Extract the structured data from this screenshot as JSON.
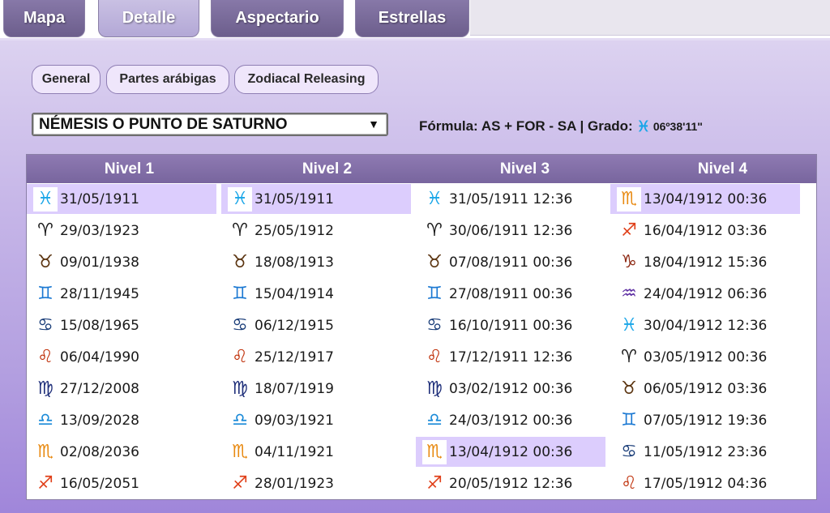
{
  "tabs": [
    {
      "label": "Mapa",
      "active": false
    },
    {
      "label": "Detalle",
      "active": true
    },
    {
      "label": "Aspectario",
      "active": false
    },
    {
      "label": "Estrellas",
      "active": false
    }
  ],
  "subtabs": [
    "General",
    "Partes arábigas",
    "Zodiacal Releasing"
  ],
  "select": {
    "value": "NÉMESIS O PUNTO DE SATURNO",
    "arrow": "▼"
  },
  "formula": {
    "label": "Fórmula: AS + FOR - SA | Grado:",
    "sign_icon": "pisces",
    "degree": "06º38'11\""
  },
  "signs": {
    "aries": {
      "glyph": "♈︎",
      "color": "#1a1a1a"
    },
    "taurus": {
      "glyph": "♉︎",
      "color": "#5b3410"
    },
    "gemini": {
      "glyph": "♊︎",
      "color": "#1a78d2"
    },
    "cancer": {
      "glyph": "♋︎",
      "color": "#1c3f7a"
    },
    "leo": {
      "glyph": "♌︎",
      "color": "#c1340e"
    },
    "virgo": {
      "glyph": "♍︎",
      "color": "#1f2f7a"
    },
    "libra": {
      "glyph": "♎︎",
      "color": "#1a8ad8"
    },
    "scorpio": {
      "glyph": "♏︎",
      "color": "#e88a12"
    },
    "sagittarius": {
      "glyph": "♐︎",
      "color": "#e0401a"
    },
    "capricorn": {
      "glyph": "♑︎",
      "color": "#8e2a14"
    },
    "aquarius": {
      "glyph": "♒︎",
      "color": "#5a2aa0"
    },
    "pisces": {
      "glyph": "♓︎",
      "color": "#1aa6e8"
    }
  },
  "table": {
    "headers": [
      "Nivel 1",
      "Nivel 2",
      "Nivel 3",
      "Nivel 4"
    ],
    "columns": [
      [
        {
          "sign": "pisces",
          "date": "31/05/1911",
          "highlight": true
        },
        {
          "sign": "aries",
          "date": "29/03/1923"
        },
        {
          "sign": "taurus",
          "date": "09/01/1938"
        },
        {
          "sign": "gemini",
          "date": "28/11/1945"
        },
        {
          "sign": "cancer",
          "date": "15/08/1965"
        },
        {
          "sign": "leo",
          "date": "06/04/1990"
        },
        {
          "sign": "virgo",
          "date": "27/12/2008"
        },
        {
          "sign": "libra",
          "date": "13/09/2028"
        },
        {
          "sign": "scorpio",
          "date": "02/08/2036"
        },
        {
          "sign": "sagittarius",
          "date": "16/05/2051"
        }
      ],
      [
        {
          "sign": "pisces",
          "date": "31/05/1911",
          "highlight": true
        },
        {
          "sign": "aries",
          "date": "25/05/1912"
        },
        {
          "sign": "taurus",
          "date": "18/08/1913"
        },
        {
          "sign": "gemini",
          "date": "15/04/1914"
        },
        {
          "sign": "cancer",
          "date": "06/12/1915"
        },
        {
          "sign": "leo",
          "date": "25/12/1917"
        },
        {
          "sign": "virgo",
          "date": "18/07/1919"
        },
        {
          "sign": "libra",
          "date": "09/03/1921"
        },
        {
          "sign": "scorpio",
          "date": "04/11/1921"
        },
        {
          "sign": "sagittarius",
          "date": "28/01/1923"
        }
      ],
      [
        {
          "sign": "pisces",
          "date": "31/05/1911 12:36"
        },
        {
          "sign": "aries",
          "date": "30/06/1911 12:36"
        },
        {
          "sign": "taurus",
          "date": "07/08/1911 00:36"
        },
        {
          "sign": "gemini",
          "date": "27/08/1911 00:36"
        },
        {
          "sign": "cancer",
          "date": "16/10/1911 00:36"
        },
        {
          "sign": "leo",
          "date": "17/12/1911 12:36"
        },
        {
          "sign": "virgo",
          "date": "03/02/1912 00:36"
        },
        {
          "sign": "libra",
          "date": "24/03/1912 00:36"
        },
        {
          "sign": "scorpio",
          "date": "13/04/1912 00:36",
          "highlight": true
        },
        {
          "sign": "sagittarius",
          "date": "20/05/1912 12:36"
        }
      ],
      [
        {
          "sign": "scorpio",
          "date": "13/04/1912 00:36",
          "highlight": true
        },
        {
          "sign": "sagittarius",
          "date": "16/04/1912 03:36"
        },
        {
          "sign": "capricorn",
          "date": "18/04/1912 15:36"
        },
        {
          "sign": "aquarius",
          "date": "24/04/1912 06:36"
        },
        {
          "sign": "pisces",
          "date": "30/04/1912 12:36"
        },
        {
          "sign": "aries",
          "date": "03/05/1912 00:36"
        },
        {
          "sign": "taurus",
          "date": "06/05/1912 03:36"
        },
        {
          "sign": "gemini",
          "date": "07/05/1912 19:36"
        },
        {
          "sign": "cancer",
          "date": "11/05/1912 23:36"
        },
        {
          "sign": "leo",
          "date": "17/05/1912 04:36"
        }
      ]
    ]
  }
}
